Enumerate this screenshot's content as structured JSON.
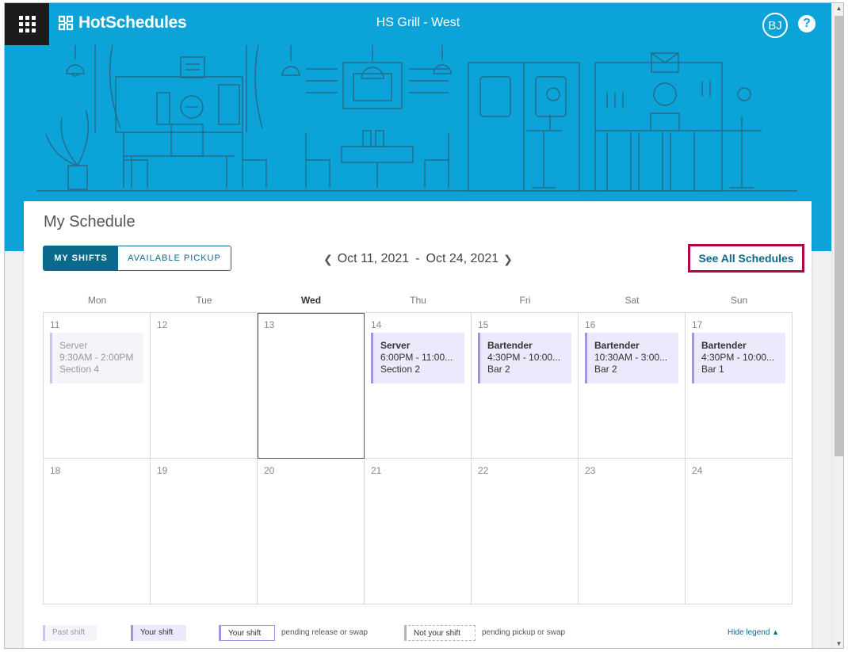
{
  "header": {
    "app_name": "HotSchedules",
    "store_name": "HS Grill - West",
    "user_initials": "BJ",
    "help_label": "?",
    "brand_color": "#0ba3d8"
  },
  "schedule": {
    "title": "My Schedule",
    "tabs": [
      {
        "label": "MY SHIFTS",
        "active": true
      },
      {
        "label": "AVAILABLE PICKUP",
        "active": false
      }
    ],
    "date_start": "Oct 11, 2021",
    "date_sep": "-",
    "date_end": "Oct 24, 2021",
    "see_all_label": "See All Schedules",
    "day_names": [
      "Mon",
      "Tue",
      "Wed",
      "Thu",
      "Fri",
      "Sat",
      "Sun"
    ],
    "today_index": 2,
    "weeks": [
      [
        {
          "day": "11",
          "shift": {
            "role": "Server",
            "time": "9:30AM - 2:00PM",
            "location": "Section 4",
            "past": true
          }
        },
        {
          "day": "12"
        },
        {
          "day": "13",
          "today": true
        },
        {
          "day": "14",
          "shift": {
            "role": "Server",
            "time": "6:00PM - 11:00...",
            "location": "Section 2"
          }
        },
        {
          "day": "15",
          "shift": {
            "role": "Bartender",
            "time": "4:30PM - 10:00...",
            "location": "Bar 2"
          }
        },
        {
          "day": "16",
          "shift": {
            "role": "Bartender",
            "time": "10:30AM - 3:00...",
            "location": "Bar 2"
          }
        },
        {
          "day": "17",
          "shift": {
            "role": "Bartender",
            "time": "4:30PM - 10:00...",
            "location": "Bar 1"
          }
        }
      ],
      [
        {
          "day": "18"
        },
        {
          "day": "19"
        },
        {
          "day": "20"
        },
        {
          "day": "21"
        },
        {
          "day": "22"
        },
        {
          "day": "23"
        },
        {
          "day": "24"
        }
      ]
    ]
  },
  "legend": {
    "past_shift": "Past shift",
    "your_shift": "Your shift",
    "your_shift_pending": "Your shift",
    "pending_release": "pending release or swap",
    "not_your_shift": "Not your shift",
    "pending_pickup": "pending pickup or swap",
    "hide_label": "Hide legend",
    "hide_icon": "chevron-up-icon"
  },
  "colors": {
    "accent": "#0b6a8c",
    "highlight_border": "#b3083f",
    "shift_fill": "#ebe9fb",
    "shift_border": "#9e95e6"
  }
}
